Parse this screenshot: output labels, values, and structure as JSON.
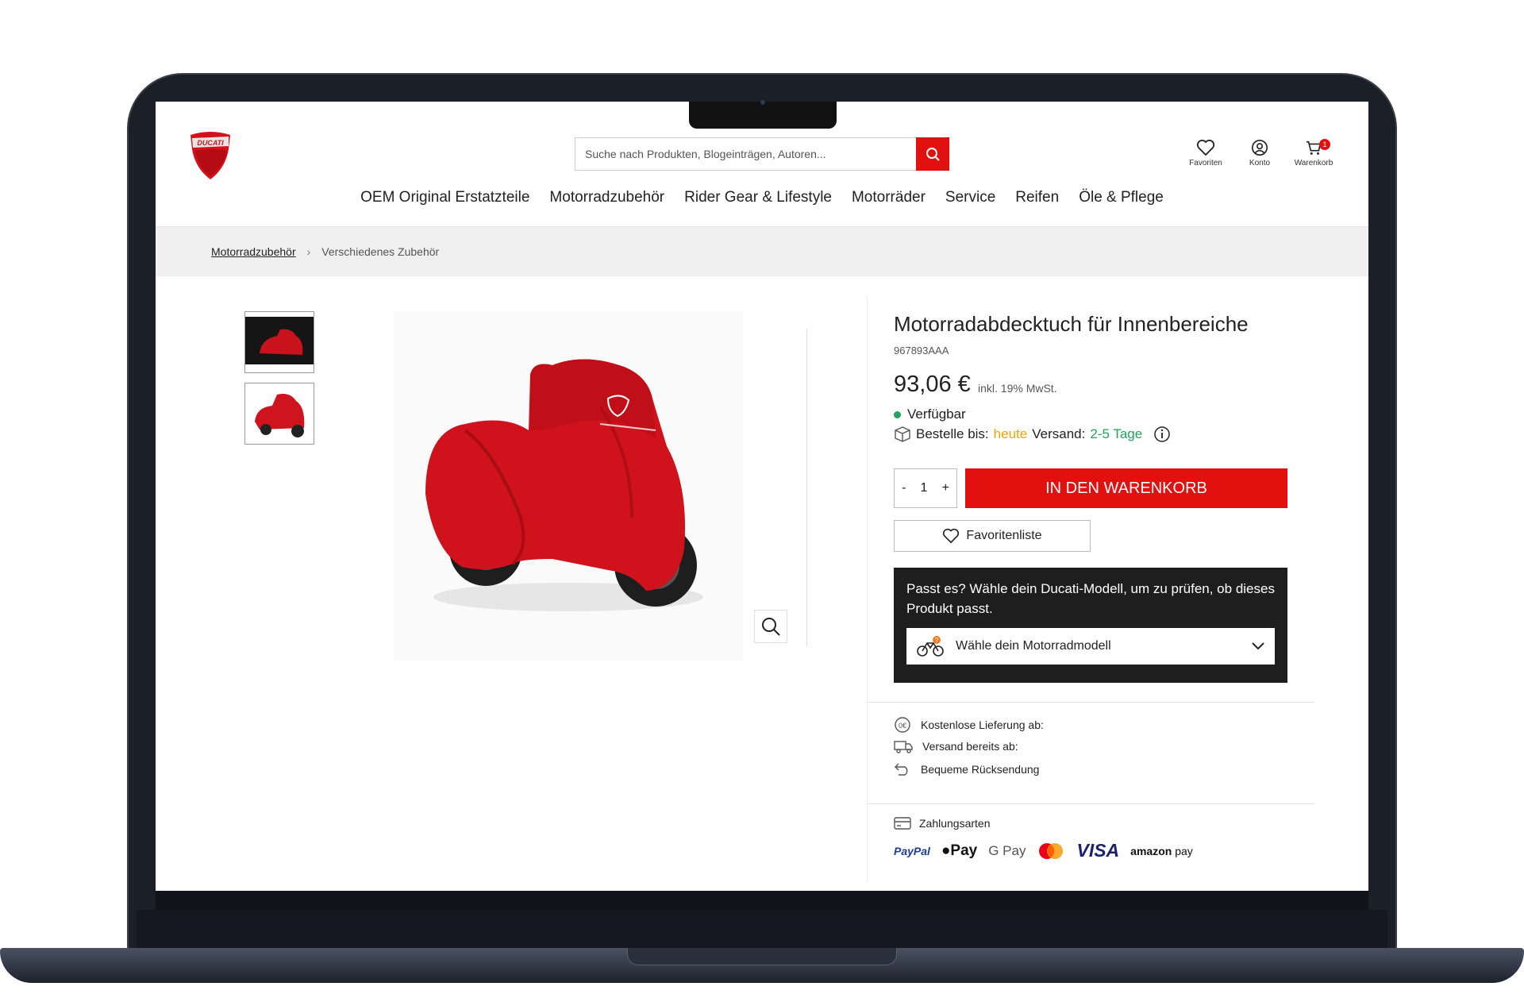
{
  "header": {
    "logo_text": "DUCATI",
    "search": {
      "placeholder": "Suche nach Produkten, Blogeinträgen, Autoren..."
    },
    "icons": {
      "favorites": "Favoriten",
      "account": "Konto",
      "cart": "Warenkorb",
      "cart_count": "1"
    }
  },
  "nav": {
    "items": [
      "OEM Original Erstatzteile",
      "Motorradzubehör",
      "Rider Gear & Lifestyle",
      "Motorräder",
      "Service",
      "Reifen",
      "Öle & Pflege"
    ]
  },
  "breadcrumb": {
    "parent": "Motorradzubehör",
    "current": "Verschiedenes Zubehör"
  },
  "product": {
    "title": "Motorradabdecktuch für Innenbereiche",
    "sku": "967893AAA",
    "price": "93,06 €",
    "tax_note": "inkl. 19% MwSt.",
    "availability": "Verfügbar",
    "order_by_label": "Bestelle bis:",
    "order_by_value": "heute",
    "shipping_label": "Versand:",
    "shipping_value": "2-5 Tage",
    "quantity": "1",
    "qty_minus": "-",
    "qty_plus": "+",
    "add_to_cart": "IN DEN WARENKORB",
    "favorites_button": "Favoritenliste"
  },
  "fitment": {
    "text": "Passt es? Wähle dein Ducati-Modell, um zu prüfen, ob dieses Produkt passt.",
    "select_label": "Wähle dein Motorradmodell"
  },
  "benefits": [
    "Kostenlose Lieferung ab:",
    "Versand bereits ab:",
    "Bequeme Rücksendung"
  ],
  "payment": {
    "label": "Zahlungsarten",
    "methods": {
      "paypal_a": "PayPal",
      "applepay": "Pay",
      "googlepay": "G Pay",
      "visa": "VISA",
      "amazon": "amazon",
      "amazon_pay": "pay"
    }
  },
  "colors": {
    "accent": "#e2100f",
    "available": "#21a35a",
    "order_highlight": "#f0a500"
  }
}
